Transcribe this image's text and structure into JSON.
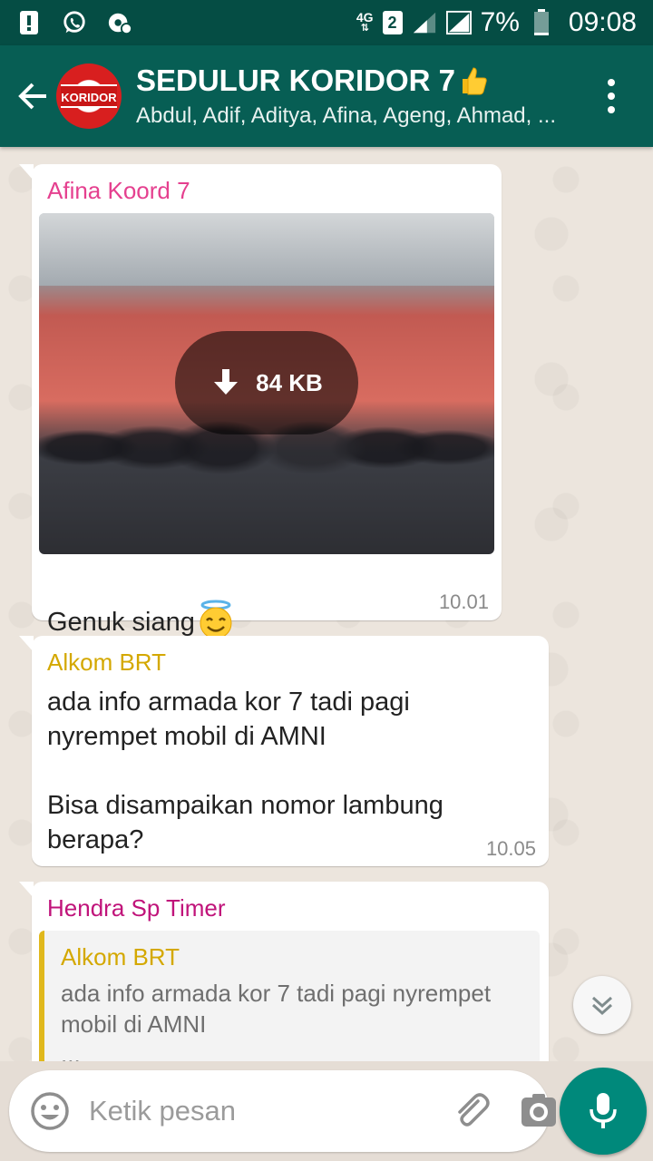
{
  "status_bar": {
    "network_label": "4G",
    "sim_label": "2",
    "battery": "7%",
    "time": "09:08"
  },
  "header": {
    "title": "SEDULUR KORIDOR 7",
    "title_emoji": "thumbs-up",
    "subtitle": "Abdul, Adif, Aditya, Afina, Ageng, Ahmad, ...",
    "avatar_text": "KORIDOR"
  },
  "messages": [
    {
      "sender": "Afina Koord 7",
      "sender_color": "#e5408f",
      "type": "image",
      "download_size": "84 KB",
      "caption": "Genuk siang",
      "caption_emoji": "smiling-face-with-halo",
      "time": "10.01"
    },
    {
      "sender": "Alkom BRT",
      "sender_color": "#d4a800",
      "type": "text",
      "text": "ada info armada kor 7 tadi pagi\nnyrempet mobil di AMNI\n\nBisa disampaikan nomor lambung\nberapa?",
      "time": "10.05"
    },
    {
      "sender": "Hendra Sp Timer",
      "sender_color": "#c0137a",
      "type": "reply",
      "quote_sender": "Alkom BRT",
      "quote_text": "ada info armada kor 7 tadi pagi nyrempet mobil di AMNI",
      "quote_more": "..."
    }
  ],
  "composer": {
    "placeholder": "Ketik pesan"
  },
  "colors": {
    "header": "#075e54",
    "status_bar": "#054d44",
    "accent": "#00897b"
  }
}
